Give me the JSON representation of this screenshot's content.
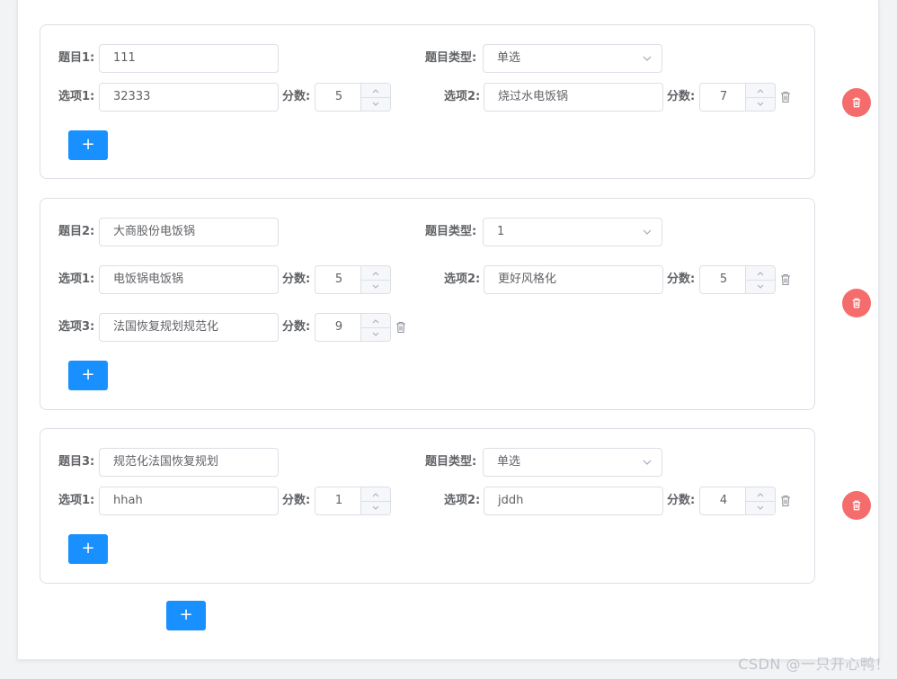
{
  "cards": [
    {
      "title_label": "题目1:",
      "title_value": "111",
      "type_label": "题目类型:",
      "type_value": "单选",
      "options": [
        {
          "label": "选项1:",
          "value": "32333",
          "score_label": "分数:",
          "score": "5"
        },
        {
          "label": "选项2:",
          "value": "烧过水电饭锅",
          "score_label": "分数:",
          "score": "7"
        }
      ],
      "add_label": "+"
    },
    {
      "title_label": "题目2:",
      "title_value": "大商股份电饭锅",
      "type_label": "题目类型:",
      "type_value": "1",
      "options": [
        {
          "label": "选项1:",
          "value": "电饭锅电饭锅",
          "score_label": "分数:",
          "score": "5"
        },
        {
          "label": "选项2:",
          "value": "更好风格化",
          "score_label": "分数:",
          "score": "5"
        },
        {
          "label": "选项3:",
          "value": "法国恢复规划规范化",
          "score_label": "分数:",
          "score": "9"
        }
      ],
      "add_label": "+"
    },
    {
      "title_label": "题目3:",
      "title_value": "规范化法国恢复规划",
      "type_label": "题目类型:",
      "type_value": "单选",
      "options": [
        {
          "label": "选项1:",
          "value": "hhah",
          "score_label": "分数:",
          "score": "1"
        },
        {
          "label": "选项2:",
          "value": "jddh",
          "score_label": "分数:",
          "score": "4"
        }
      ],
      "add_label": "+"
    }
  ],
  "add_question_label": "+",
  "watermark": "CSDN @一只开心鸭！",
  "colors": {
    "primary": "#1890ff",
    "danger": "#f56c6c",
    "border": "#dcdfe6"
  },
  "icons": {
    "select": "chevron-down-icon",
    "trash": "trash-icon",
    "delete": "delete-icon",
    "plus": "plus-icon"
  }
}
